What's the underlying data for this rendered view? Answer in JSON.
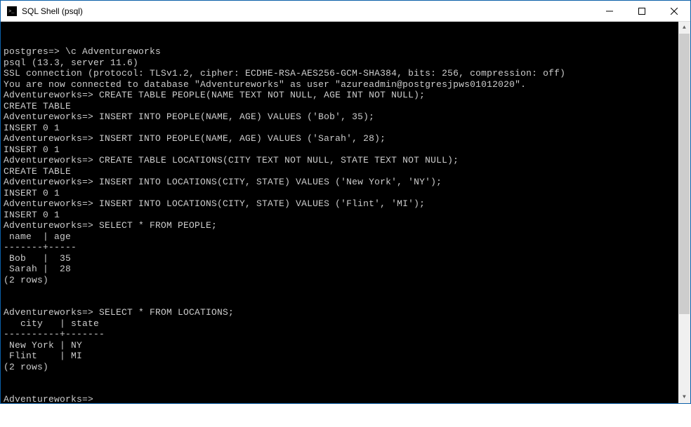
{
  "window": {
    "title": "SQL Shell (psql)"
  },
  "terminal": {
    "lines": [
      "postgres=> \\c Adventureworks",
      "psql (13.3, server 11.6)",
      "SSL connection (protocol: TLSv1.2, cipher: ECDHE-RSA-AES256-GCM-SHA384, bits: 256, compression: off)",
      "You are now connected to database \"Adventureworks\" as user \"azureadmin@postgresjpws01012020\".",
      "Adventureworks=> CREATE TABLE PEOPLE(NAME TEXT NOT NULL, AGE INT NOT NULL);",
      "CREATE TABLE",
      "Adventureworks=> INSERT INTO PEOPLE(NAME, AGE) VALUES ('Bob', 35);",
      "INSERT 0 1",
      "Adventureworks=> INSERT INTO PEOPLE(NAME, AGE) VALUES ('Sarah', 28);",
      "INSERT 0 1",
      "Adventureworks=> CREATE TABLE LOCATIONS(CITY TEXT NOT NULL, STATE TEXT NOT NULL);",
      "CREATE TABLE",
      "Adventureworks=> INSERT INTO LOCATIONS(CITY, STATE) VALUES ('New York', 'NY');",
      "INSERT 0 1",
      "Adventureworks=> INSERT INTO LOCATIONS(CITY, STATE) VALUES ('Flint', 'MI');",
      "INSERT 0 1",
      "Adventureworks=> SELECT * FROM PEOPLE;",
      " name  | age",
      "-------+-----",
      " Bob   |  35",
      " Sarah |  28",
      "(2 rows)",
      "",
      "",
      "Adventureworks=> SELECT * FROM LOCATIONS;",
      "   city   | state",
      "----------+-------",
      " New York | NY",
      " Flint    | MI",
      "(2 rows)",
      "",
      "",
      "Adventureworks=>"
    ]
  }
}
